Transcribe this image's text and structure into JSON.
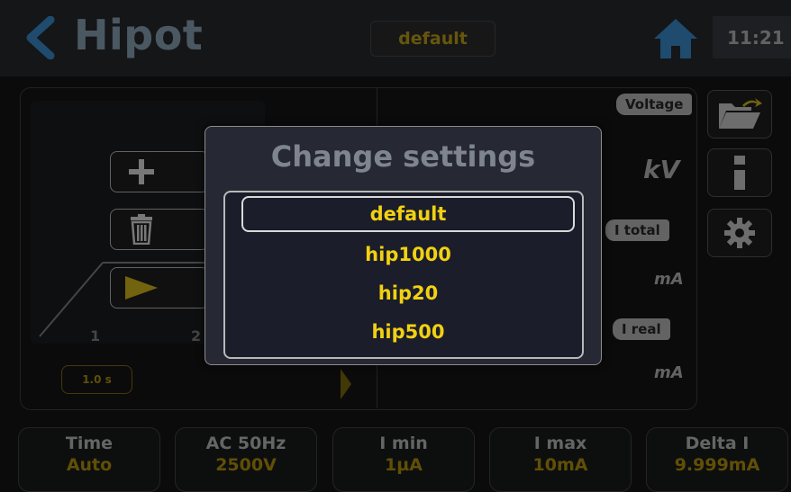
{
  "header": {
    "title": "Hipot",
    "profile": "default",
    "clock": "11:21"
  },
  "graph": {
    "step_labels": [
      "1",
      "2"
    ],
    "time_chip": "1.0 s"
  },
  "measure": {
    "voltage_tab": "Voltage",
    "voltage_unit": "kV",
    "itotal_tab": "I total",
    "itotal_unit": "mA",
    "ireal_tab": "I real",
    "ireal_unit": "mA"
  },
  "bottom_cards": [
    {
      "label": "Time",
      "value": "Auto"
    },
    {
      "label": "AC 50Hz",
      "value": "2500V"
    },
    {
      "label": "I min",
      "value": "1µA"
    },
    {
      "label": "I max",
      "value": "10mA"
    },
    {
      "label": "Delta I",
      "value": "9.999mA"
    }
  ],
  "modal": {
    "title": "Change settings",
    "items": [
      "default",
      "hip1000",
      "hip20",
      "hip500"
    ],
    "selected": "default"
  },
  "colors": {
    "accent_yellow": "#f1d112",
    "title_blue": "#8aa9bd",
    "modal_bg": "#262833"
  },
  "icons": {
    "back": "chevron-left-icon",
    "home": "home-icon",
    "folder": "folder-open-icon",
    "info": "info-icon",
    "settings": "gear-icon",
    "add": "plus-icon",
    "delete": "trash-icon",
    "run": "play-icon"
  }
}
